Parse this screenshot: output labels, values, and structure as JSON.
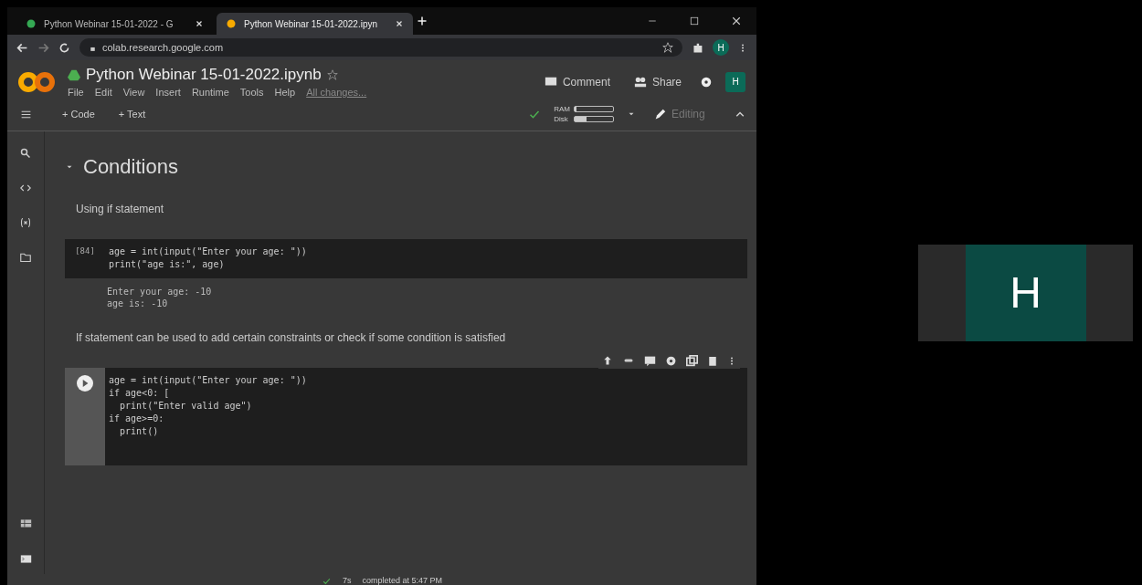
{
  "browser": {
    "tabs": [
      {
        "title": "Python Webinar 15-01-2022 - G",
        "selected": false
      },
      {
        "title": "Python Webinar 15-01-2022.ipyn",
        "selected": true
      }
    ],
    "url": "colab.research.google.com",
    "avatar": "H"
  },
  "notebook": {
    "title": "Python Webinar 15-01-2022.ipynb",
    "menu": [
      "File",
      "Edit",
      "View",
      "Insert",
      "Runtime",
      "Tools",
      "Help"
    ],
    "save_status": "All changes...",
    "comment": "Comment",
    "share": "Share",
    "avatar": "H",
    "toolbar": [
      "+ Code",
      "+ Text"
    ],
    "resources": [
      {
        "label": "RAM",
        "level": 0.05
      },
      {
        "label": "Disk",
        "level": 0.3
      }
    ],
    "editing": "Editing",
    "cells": [
      {
        "kind": "heading",
        "text": "Conditions"
      },
      {
        "kind": "text",
        "text": "Using if statement"
      },
      {
        "kind": "code",
        "focused": false,
        "count": "[84]",
        "lines": [
          "age = int(input(\"Enter your age: \"))",
          "print(\"age is:\", age)"
        ]
      },
      {
        "kind": "output",
        "lines": [
          "Enter your age: -10",
          "age is: -10"
        ]
      },
      {
        "kind": "text",
        "text": "If statement can be used to add certain constraints or check if some condition is satisfied"
      },
      {
        "kind": "code",
        "focused": true,
        "lines": [
          "age = int(input(\"Enter your age: \"))",
          "if age<0: [",
          "  print(\"Enter valid age\")",
          "if age>=0:",
          "  print()"
        ]
      }
    ]
  },
  "status_bar": {
    "duration": "7s",
    "text": "completed at 5:47 PM"
  },
  "participant": {
    "initial": "H"
  }
}
